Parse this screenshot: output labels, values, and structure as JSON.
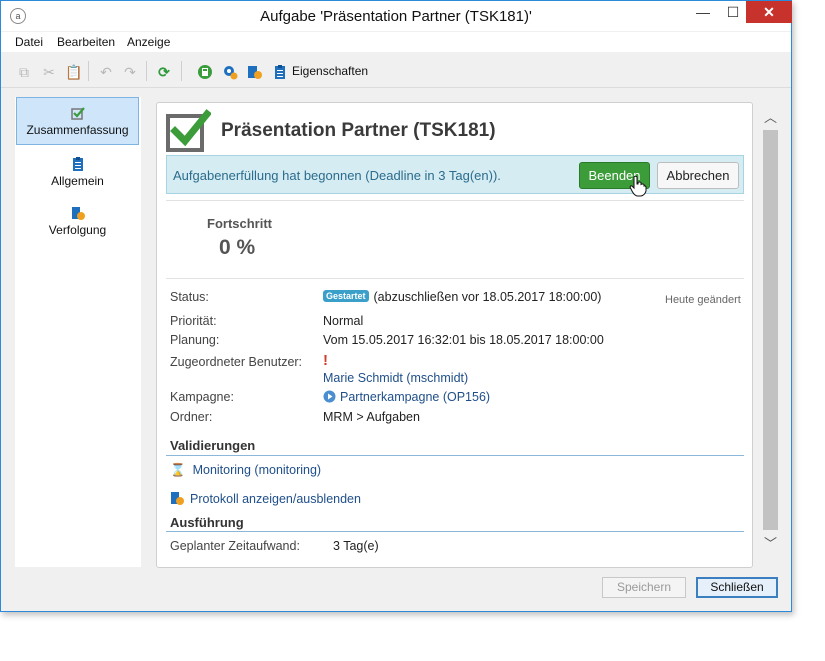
{
  "window": {
    "title": "Aufgabe 'Präsentation Partner (TSK181)'",
    "app_icon_glyph": "a",
    "controls": {
      "minimize": "—",
      "maximize": "☐",
      "close": "✕"
    }
  },
  "menu": [
    "Datei",
    "Bearbeiten",
    "Anzeige"
  ],
  "toolbar": {
    "properties_label": "Eigenschaften",
    "icons": [
      "copy-icon",
      "cut-icon",
      "paste-icon",
      "undo-icon",
      "redo-icon",
      "refresh-icon",
      "calculator-icon",
      "settings-icon",
      "tracking-icon",
      "clipboard-icon"
    ]
  },
  "nav": {
    "items": [
      {
        "label": "Zusammenfassung",
        "icon": "summary-check-icon",
        "active": true
      },
      {
        "label": "Allgemein",
        "icon": "clipboard-icon",
        "active": false
      },
      {
        "label": "Verfolgung",
        "icon": "tracking-icon",
        "active": false
      }
    ]
  },
  "task": {
    "title": "Präsentation Partner (TSK181)",
    "banner_text": "Aufgabenerfüllung hat begonnen (Deadline in 3 Tag(en)).",
    "finish_button": "Beenden",
    "cancel_button": "Abbrechen",
    "progress_label": "Fortschritt",
    "progress_value": "0 %",
    "changed_text": "Heute geändert",
    "fields": {
      "status_label": "Status:",
      "status_badge": "Gestartet",
      "status_value": "(abzuschließen vor 18.05.2017 18:00:00)",
      "priority_label": "Priorität:",
      "priority_value": "Normal",
      "planning_label": "Planung:",
      "planning_value": "Vom 15.05.2017 16:32:01 bis 18.05.2017 18:00:00",
      "assignee_label": "Zugeordneter Benutzer:",
      "assignee_value": "Marie Schmidt (mschmidt)",
      "campaign_label": "Kampagne:",
      "campaign_value": "Partnerkampagne (OP156)",
      "folder_label": "Ordner:",
      "folder_value": "MRM > Aufgaben"
    },
    "validations_title": "Validierungen",
    "validation_link": "Monitoring (monitoring)",
    "log_toggle_link": "Protokoll anzeigen/ausblenden",
    "execution_title": "Ausführung",
    "effort_label": "Geplanter Zeitaufwand:",
    "effort_value": "3 Tag(e)"
  },
  "footer": {
    "save_button": "Speichern",
    "close_button": "Schließen"
  },
  "colors": {
    "accent": "#2c8ad8",
    "finish_green": "#3c9c3a",
    "banner_bg": "#d6ecf3",
    "link": "#1f4f8a",
    "badge": "#3aa0c9",
    "close_red": "#c7322d"
  }
}
